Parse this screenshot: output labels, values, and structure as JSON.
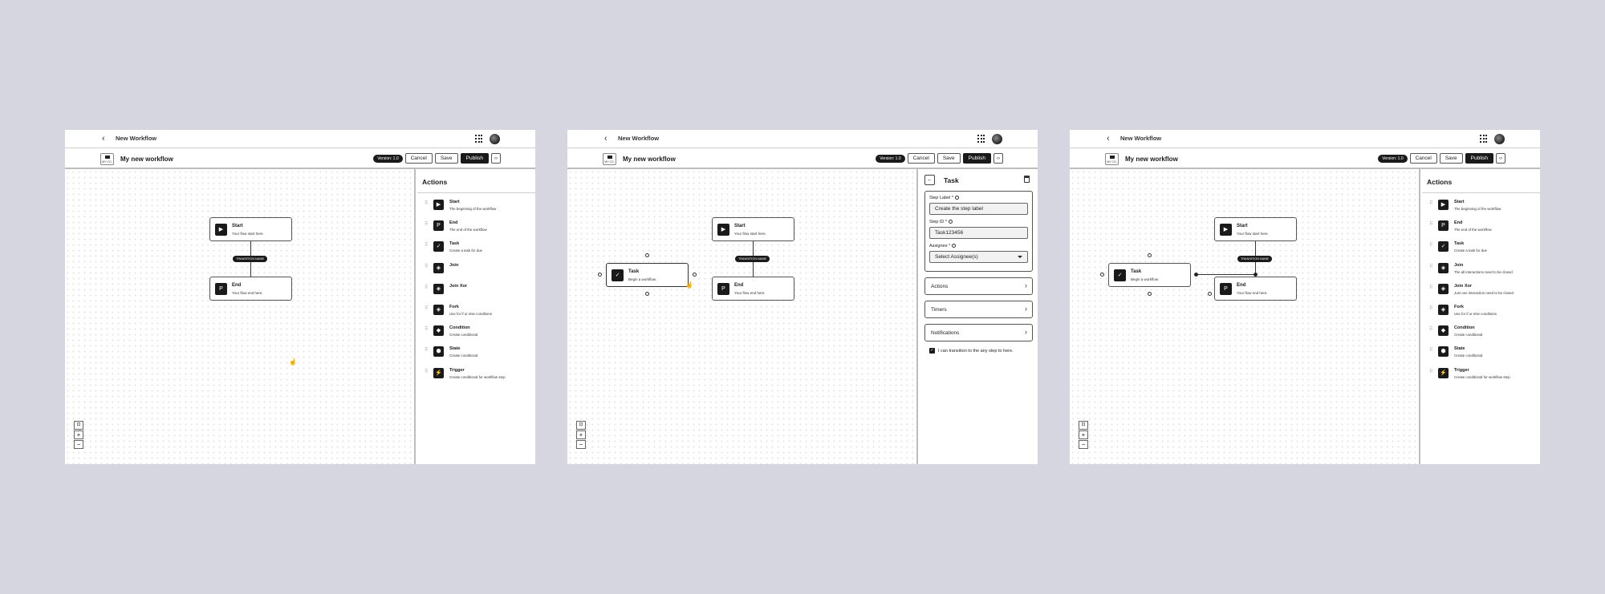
{
  "header": {
    "page_title": "New Workflow",
    "workflow_name": "My new workflow",
    "logo_text": "MY CO.",
    "version": "Version: 1.0",
    "cancel": "Cancel",
    "save": "Save",
    "publish": "Publish",
    "code": "‹›"
  },
  "canvas": {
    "start": {
      "title": "Start",
      "desc": "Your flow start here."
    },
    "end": {
      "title": "End",
      "desc": "Your flow end here."
    },
    "task": {
      "title": "Task",
      "desc": "Begin a workflow."
    },
    "transition": "TRANSITION NAME",
    "zoom": {
      "fit": "⊡",
      "in": "+",
      "out": "−"
    }
  },
  "actions_panel": {
    "title": "Actions",
    "items": [
      {
        "label": "Start",
        "desc": "The beginning of the workflow",
        "glyph": "▶"
      },
      {
        "label": "End",
        "desc": "The end of the workflow",
        "glyph": "P"
      },
      {
        "label": "Task",
        "desc": "Create a task for due",
        "glyph": "✓"
      },
      {
        "label": "Join",
        "desc": "",
        "glyph": "◈"
      },
      {
        "label": "Join Xor",
        "desc": "",
        "glyph": "◈"
      },
      {
        "label": "Fork",
        "desc": "Use for if or else conditions",
        "glyph": "◈"
      },
      {
        "label": "Condition",
        "desc": "Create conditional",
        "glyph": "◆"
      },
      {
        "label": "State",
        "desc": "Create conditional",
        "glyph": "⬢"
      },
      {
        "label": "Trigger",
        "desc": "Create conditional for workflow step",
        "glyph": "⚡"
      }
    ],
    "items_v3": [
      {
        "label": "Start",
        "desc": "The beginning of the workflow",
        "glyph": "▶"
      },
      {
        "label": "End",
        "desc": "The end of the workflow",
        "glyph": "P"
      },
      {
        "label": "Task",
        "desc": "Create a task for due",
        "glyph": "✓"
      },
      {
        "label": "Join",
        "desc": "The all interactions need to be closed",
        "glyph": "◈"
      },
      {
        "label": "Join Xor",
        "desc": "Just one interaction need to be closed",
        "glyph": "◈"
      },
      {
        "label": "Fork",
        "desc": "Use for if or else conditions",
        "glyph": "◈"
      },
      {
        "label": "Condition",
        "desc": "Create conditional",
        "glyph": "◆"
      },
      {
        "label": "State",
        "desc": "Create conditional",
        "glyph": "⬢"
      },
      {
        "label": "Trigger",
        "desc": "Create conditional for workflow step",
        "glyph": "⚡"
      }
    ]
  },
  "task_panel": {
    "title": "Task",
    "step_label": "Step Label *",
    "step_label_value": "Create the step label",
    "step_id": "Step ID *",
    "step_id_value": "Task123456",
    "assignee": "Assignee *",
    "assignee_value": "Select Assignee(s)",
    "sections": [
      "Actions",
      "Timers",
      "Notifications"
    ],
    "checkbox_label": "I can transition to the any step to here."
  },
  "icons": {
    "back": "chevron-left-icon",
    "apps": "grid-icon",
    "trash": "trash-icon"
  }
}
